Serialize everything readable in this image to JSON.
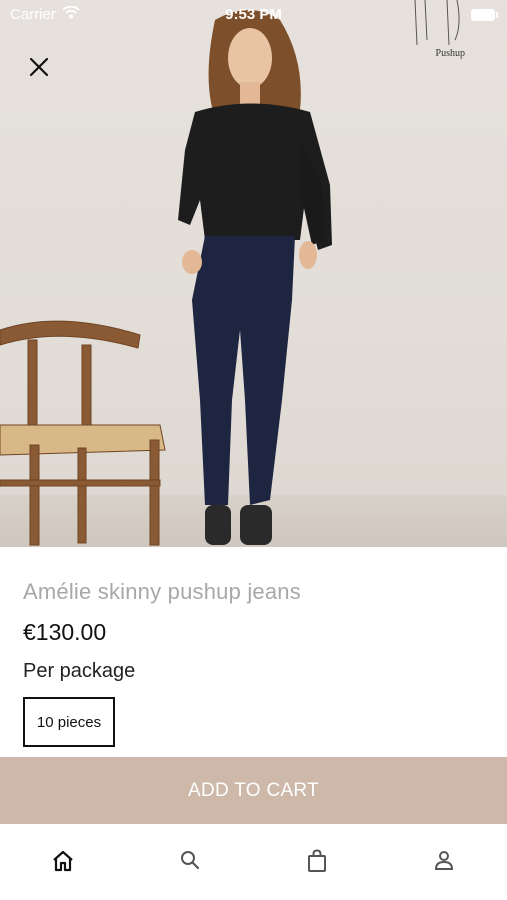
{
  "status_bar": {
    "carrier": "Carrier",
    "time": "9:53 PM"
  },
  "hero": {
    "brand_label": "Pushup"
  },
  "product": {
    "name": "Amélie skinny pushup jeans",
    "price": "€130.00",
    "package_label": "Per package",
    "option": "10 pieces"
  },
  "actions": {
    "add_to_cart": "ADD TO CART"
  },
  "tabbar": {
    "tabs": [
      {
        "icon": "home-icon",
        "active": true
      },
      {
        "icon": "search-icon",
        "active": false
      },
      {
        "icon": "shopping-bag-icon",
        "active": false
      },
      {
        "icon": "user-icon",
        "active": false
      }
    ]
  },
  "colors": {
    "accent": "#cdb8a9",
    "text_muted": "#a8a8a8",
    "text": "#111111"
  }
}
